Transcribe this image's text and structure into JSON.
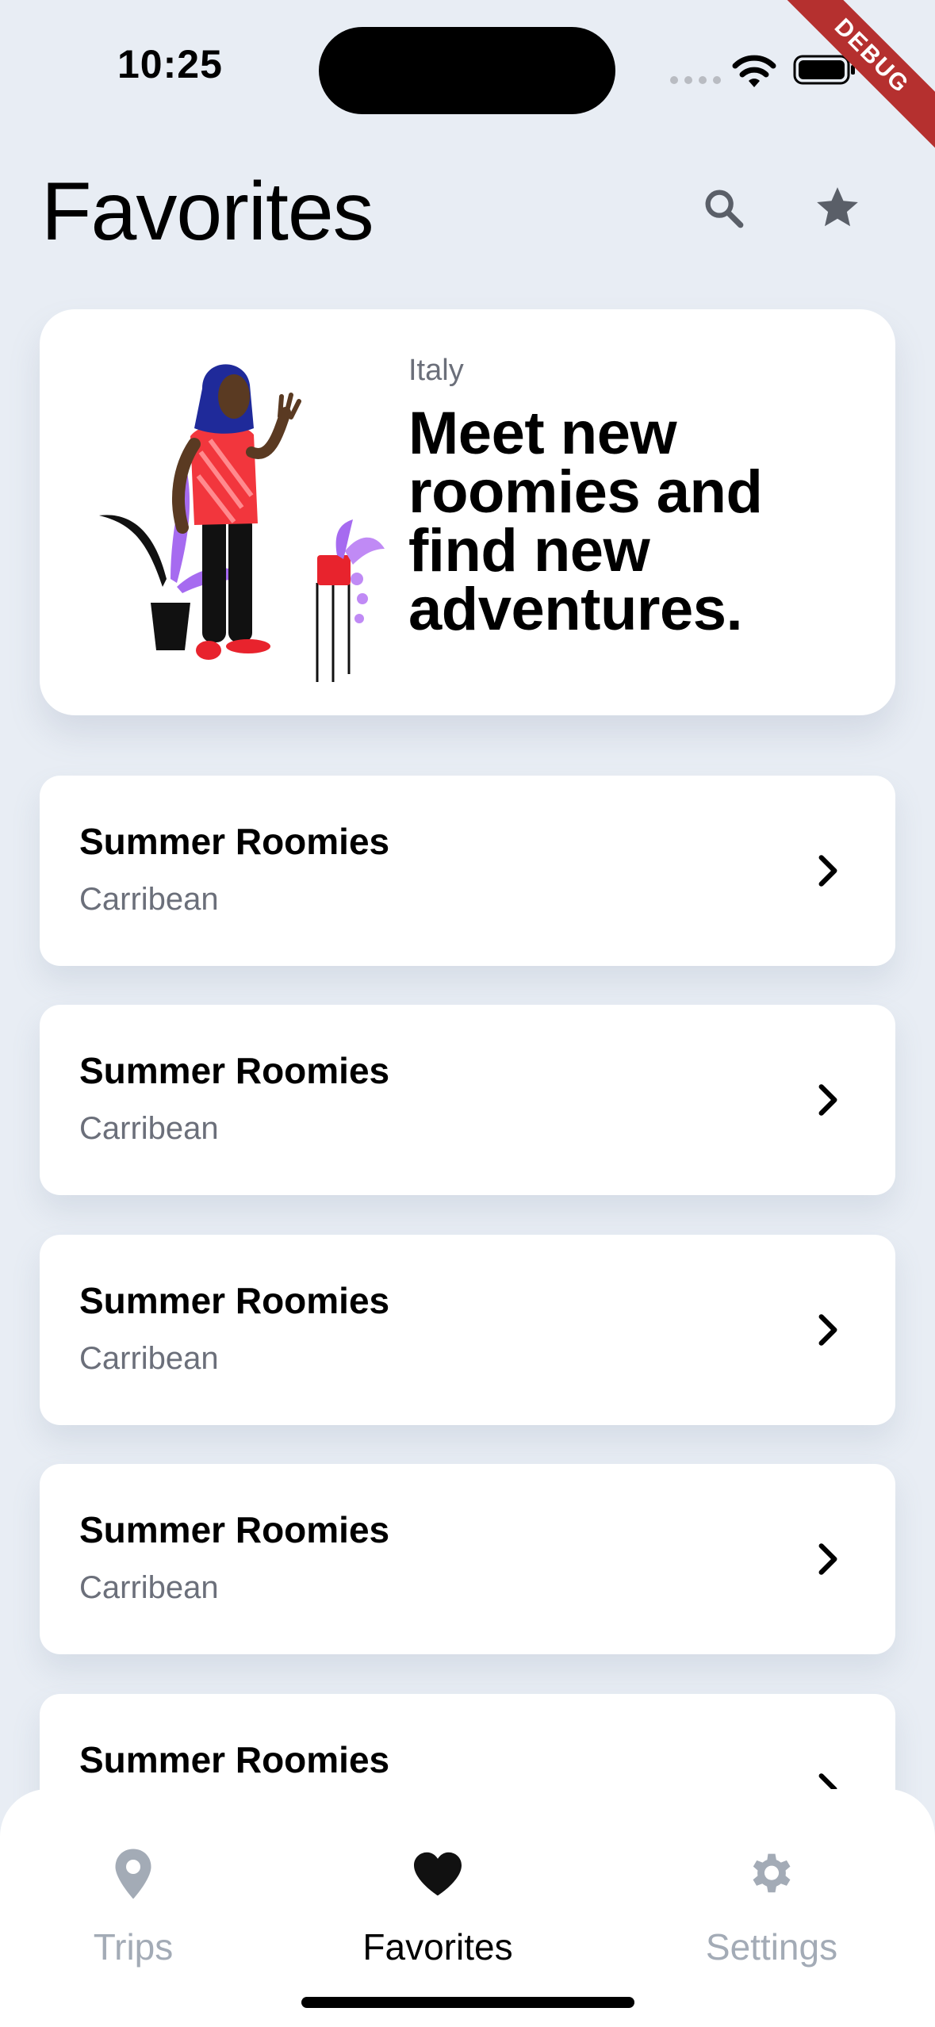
{
  "status_bar": {
    "time": "10:25",
    "debug_label": "DEBUG"
  },
  "header": {
    "title": "Favorites",
    "search_icon": "search-icon",
    "star_icon": "star-icon"
  },
  "hero": {
    "country": "Italy",
    "headline": "Meet new roomies and find new adventures."
  },
  "list": [
    {
      "title": "Summer Roomies",
      "subtitle": "Carribean"
    },
    {
      "title": "Summer Roomies",
      "subtitle": "Carribean"
    },
    {
      "title": "Summer Roomies",
      "subtitle": "Carribean"
    },
    {
      "title": "Summer Roomies",
      "subtitle": "Carribean"
    },
    {
      "title": "Summer Roomies",
      "subtitle": ""
    }
  ],
  "bottom_nav": {
    "items": [
      {
        "label": "Trips",
        "icon": "location-pin-icon",
        "active": false
      },
      {
        "label": "Favorites",
        "icon": "heart-icon",
        "active": true
      },
      {
        "label": "Settings",
        "icon": "gear-icon",
        "active": false
      }
    ]
  },
  "colors": {
    "background": "#e8edf4",
    "card": "#ffffff",
    "nav_inactive": "#a3abb6",
    "nav_active": "#000000",
    "debug_ribbon": "#b5302f"
  }
}
